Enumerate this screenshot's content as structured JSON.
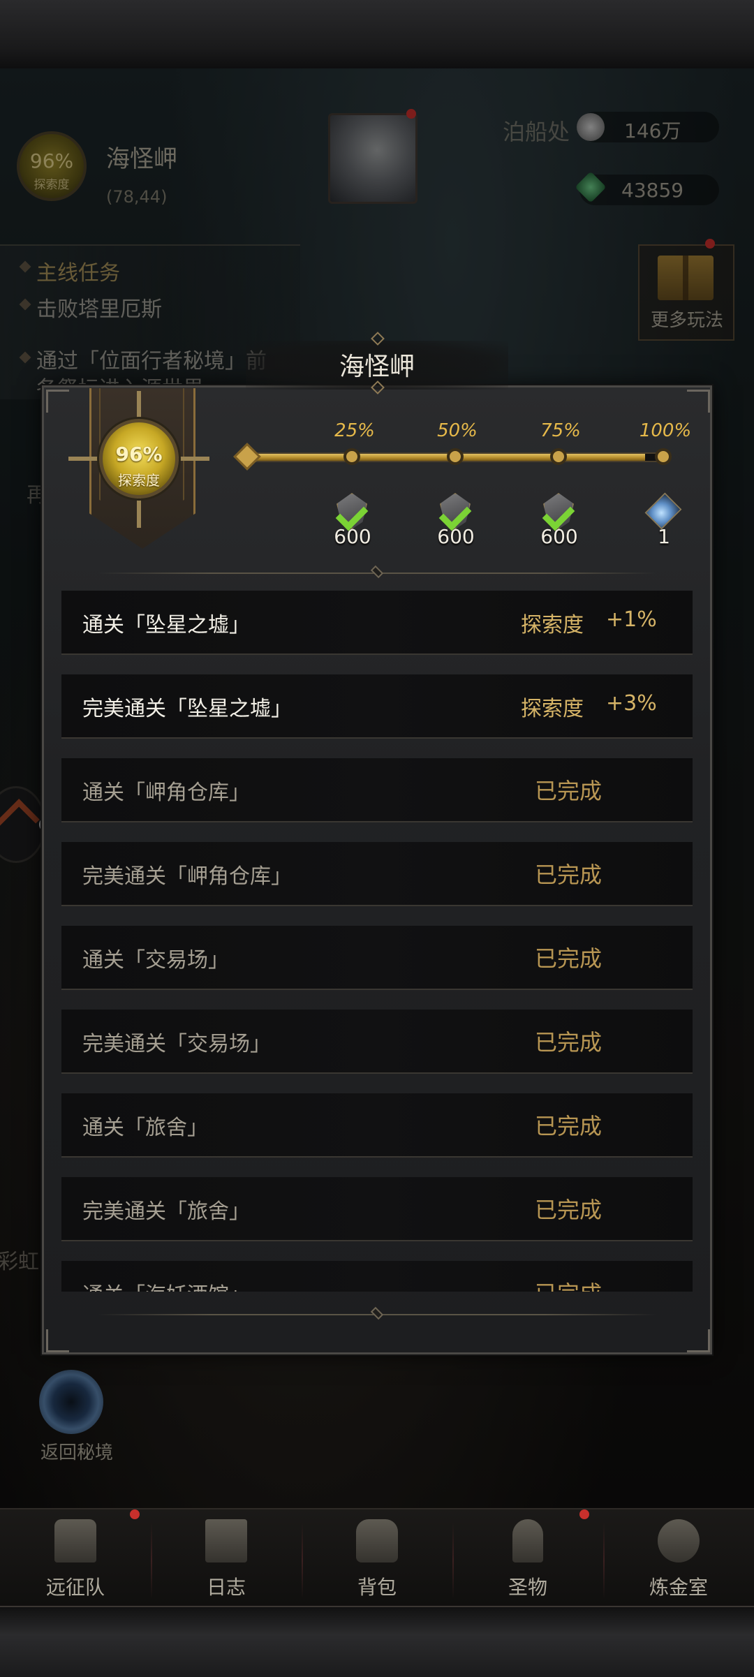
{
  "hud": {
    "explore_pct": "96%",
    "explore_label": "探索度",
    "location_name": "海怪岬",
    "coords": "(78,44)",
    "resource_partial_label": "泊船处",
    "resource_1_value": "146万",
    "resource_2_value": "43859",
    "more_label": "更多玩法",
    "side_text_left": "再",
    "side_text_rainbow": "彩虹",
    "return_label": "返回秘境"
  },
  "quest": {
    "title": "主线任务",
    "line1": "击败塔里厄斯",
    "line2": "通过「位面行者秘境」前",
    "line3": "各祭坛进入源世界"
  },
  "modal": {
    "title": "海怪岬",
    "explore_pct": "96%",
    "explore_label": "探索度",
    "progress_fraction": 0.96,
    "milestones": [
      {
        "label": "25%",
        "reward_icon": "shield-token-icon",
        "count": "600",
        "claimed": true
      },
      {
        "label": "50%",
        "reward_icon": "shield-token-icon",
        "count": "600",
        "claimed": true
      },
      {
        "label": "75%",
        "reward_icon": "shield-token-icon",
        "count": "600",
        "claimed": true
      },
      {
        "label": "100%",
        "reward_icon": "crystal-vial-icon",
        "count": "1",
        "claimed": false
      }
    ],
    "tasks": [
      {
        "name": "通关「坠星之墟」",
        "reward_label": "探索度",
        "reward_bonus": "+1%",
        "status": ""
      },
      {
        "name": "完美通关「坠星之墟」",
        "reward_label": "探索度",
        "reward_bonus": "+3%",
        "status": ""
      },
      {
        "name": "通关「岬角仓库」",
        "reward_label": "",
        "reward_bonus": "",
        "status": "已完成"
      },
      {
        "name": "完美通关「岬角仓库」",
        "reward_label": "",
        "reward_bonus": "",
        "status": "已完成"
      },
      {
        "name": "通关「交易场」",
        "reward_label": "",
        "reward_bonus": "",
        "status": "已完成"
      },
      {
        "name": "完美通关「交易场」",
        "reward_label": "",
        "reward_bonus": "",
        "status": "已完成"
      },
      {
        "name": "通关「旅舍」",
        "reward_label": "",
        "reward_bonus": "",
        "status": "已完成"
      },
      {
        "name": "完美通关「旅舍」",
        "reward_label": "",
        "reward_bonus": "",
        "status": "已完成"
      },
      {
        "name": "通关「海妖酒馆」",
        "reward_label": "",
        "reward_bonus": "",
        "status": "已完成"
      }
    ]
  },
  "nav": [
    {
      "label": "远征队",
      "icon": "helmet-icon",
      "alert": true
    },
    {
      "label": "日志",
      "icon": "scroll-icon",
      "alert": false
    },
    {
      "label": "背包",
      "icon": "backpack-icon",
      "alert": false
    },
    {
      "label": "圣物",
      "icon": "chalice-icon",
      "alert": true
    },
    {
      "label": "炼金室",
      "icon": "alchemy-icon",
      "alert": false
    }
  ],
  "colors": {
    "accent_gold": "#d6b467",
    "done_gold": "#b89653",
    "check_green": "#7bd335"
  }
}
